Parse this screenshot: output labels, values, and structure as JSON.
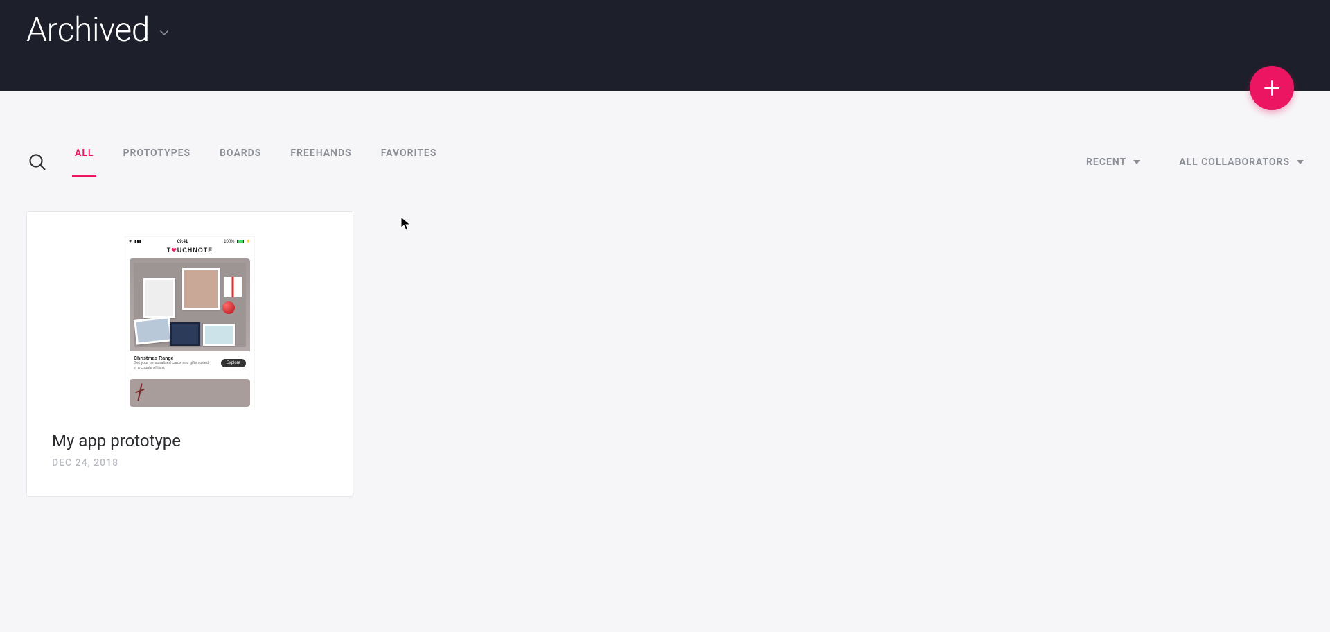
{
  "header": {
    "title": "Archived"
  },
  "fab": {
    "name": "create-new"
  },
  "tabs": {
    "items": [
      {
        "id": "all",
        "label": "ALL",
        "active": true
      },
      {
        "id": "prototypes",
        "label": "PROTOTYPES",
        "active": false
      },
      {
        "id": "boards",
        "label": "BOARDS",
        "active": false
      },
      {
        "id": "freehands",
        "label": "FREEHANDS",
        "active": false
      },
      {
        "id": "favorites",
        "label": "FAVORITES",
        "active": false
      }
    ]
  },
  "filters": {
    "sort": {
      "label": "RECENT"
    },
    "collab": {
      "label": "ALL COLLABORATORS"
    }
  },
  "projects": [
    {
      "title": "My app prototype",
      "date": "DEC 24, 2018",
      "preview": {
        "brand": "TOUCHNOTE",
        "time": "09:41",
        "battery": "100%",
        "hero_title": "Christmas Range",
        "hero_sub": "Get your personalised cards and gifts sorted in a couple of taps",
        "hero_cta": "Explore"
      }
    }
  ],
  "colors": {
    "accent": "#ec1561",
    "header_bg": "#1d1f2a",
    "page_bg": "#f6f6f8",
    "muted": "#8a8e97"
  }
}
